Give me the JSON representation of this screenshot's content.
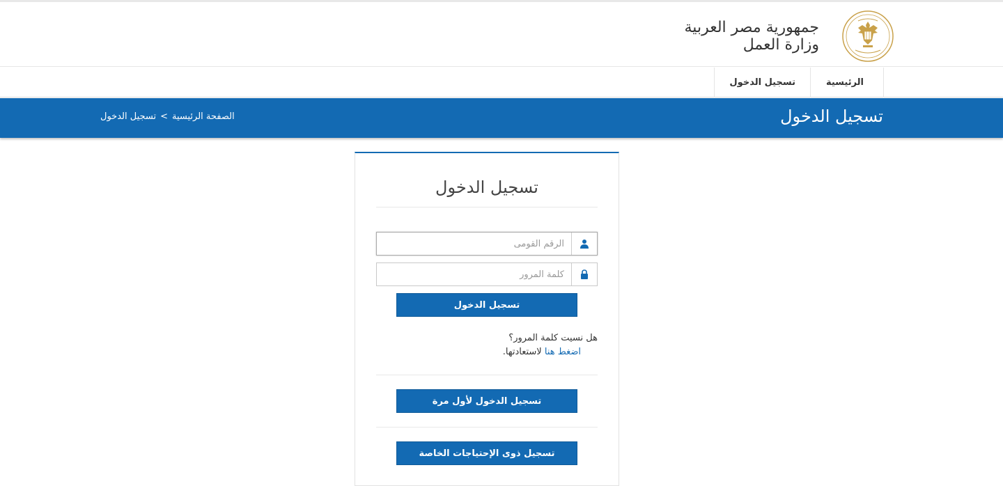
{
  "header": {
    "title_line1": "جمهورية مصر العربية",
    "title_line2": "وزارة العمل"
  },
  "nav": {
    "items": [
      {
        "label": "الرئيسية"
      },
      {
        "label": "تسجيل الدخول"
      }
    ]
  },
  "page": {
    "title": "تسجيل الدخول",
    "breadcrumb": {
      "home": "الصفحة الرئيسية",
      "separator": ">",
      "current": "تسجيل الدخول"
    }
  },
  "login": {
    "title": "تسجيل الدخول",
    "national_id_placeholder": "الرقم القومى",
    "password_placeholder": "كلمة المرور",
    "submit_label": "تسجيل الدخول",
    "forgot_question": "هل نسيت كلمة المرور؟",
    "forgot_link": "اضغط هنا",
    "forgot_suffix": "لاستعادتها.",
    "first_time_label": "تسجيل الدخول لأول مرة",
    "special_needs_label": "تسجيل ذوى الإحتياجات الخاصة"
  },
  "colors": {
    "primary": "#136ab3",
    "seal_gold": "#c9a14a"
  },
  "icons": {
    "user_field": "user-icon",
    "password_field": "lock-icon",
    "logo": "ministry-seal-logo"
  }
}
